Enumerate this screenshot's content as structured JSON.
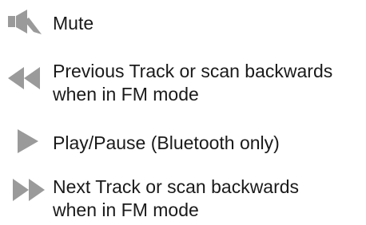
{
  "legend": {
    "icon_color": "#9a9a9a",
    "items": [
      {
        "icon": "mute-icon",
        "line1": "Mute",
        "line2": ""
      },
      {
        "icon": "rewind-icon",
        "line1": "Previous Track or scan backwards",
        "line2": "when in FM mode"
      },
      {
        "icon": "play-icon",
        "line1": "Play/Pause (Bluetooth only)",
        "line2": ""
      },
      {
        "icon": "fast-forward-icon",
        "line1": "Next Track or scan backwards",
        "line2": "when in FM mode"
      }
    ]
  }
}
